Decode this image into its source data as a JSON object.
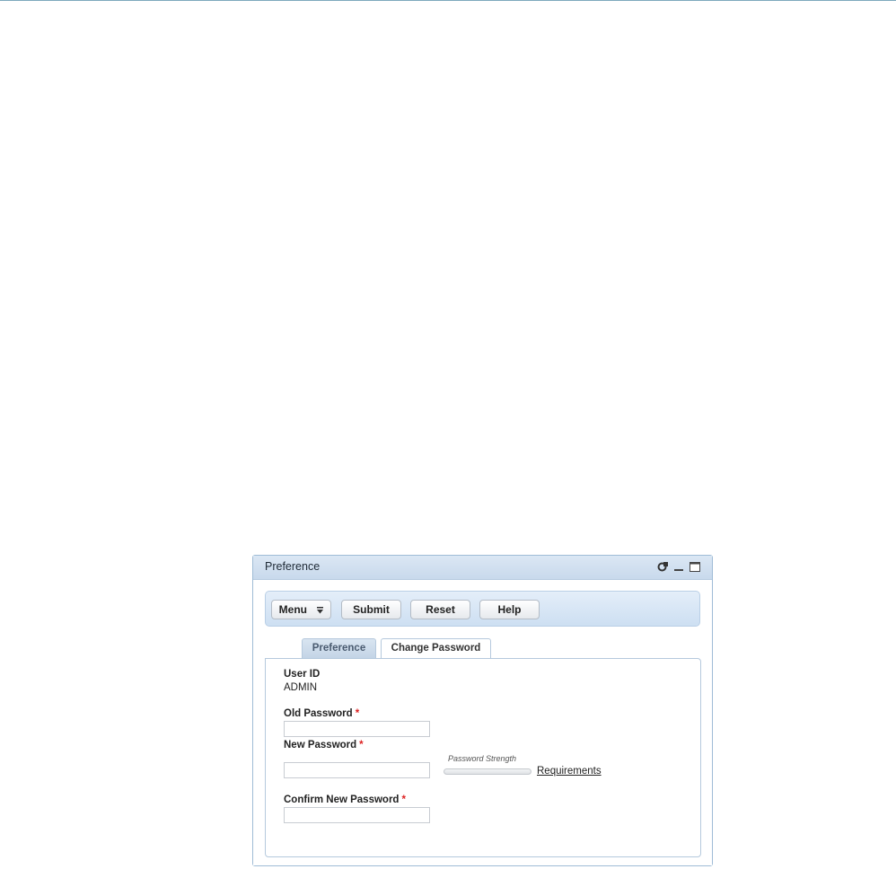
{
  "window": {
    "title": "Preference"
  },
  "toolbar": {
    "menu_label": "Menu",
    "submit_label": "Submit",
    "reset_label": "Reset",
    "help_label": "Help"
  },
  "tabs": [
    {
      "label": "Preference",
      "active": false
    },
    {
      "label": "Change Password",
      "active": true
    }
  ],
  "form": {
    "user_id_label": "User ID",
    "user_id_value": "ADMIN",
    "old_password_label": "Old Password",
    "new_password_label": "New Password",
    "confirm_password_label": "Confirm New Password",
    "required_marker": "*",
    "old_password_value": "",
    "new_password_value": "",
    "confirm_password_value": "",
    "strength_label": "Password Strength",
    "strength_level": 0,
    "requirements_link": "Requirements"
  },
  "colors": {
    "accent": "#c8d9ec",
    "required": "#dd2222"
  },
  "icons": {
    "window_controls": [
      "refresh-icon",
      "minimize-icon",
      "maximize-icon"
    ],
    "menu": "menu-dropdown-icon"
  }
}
